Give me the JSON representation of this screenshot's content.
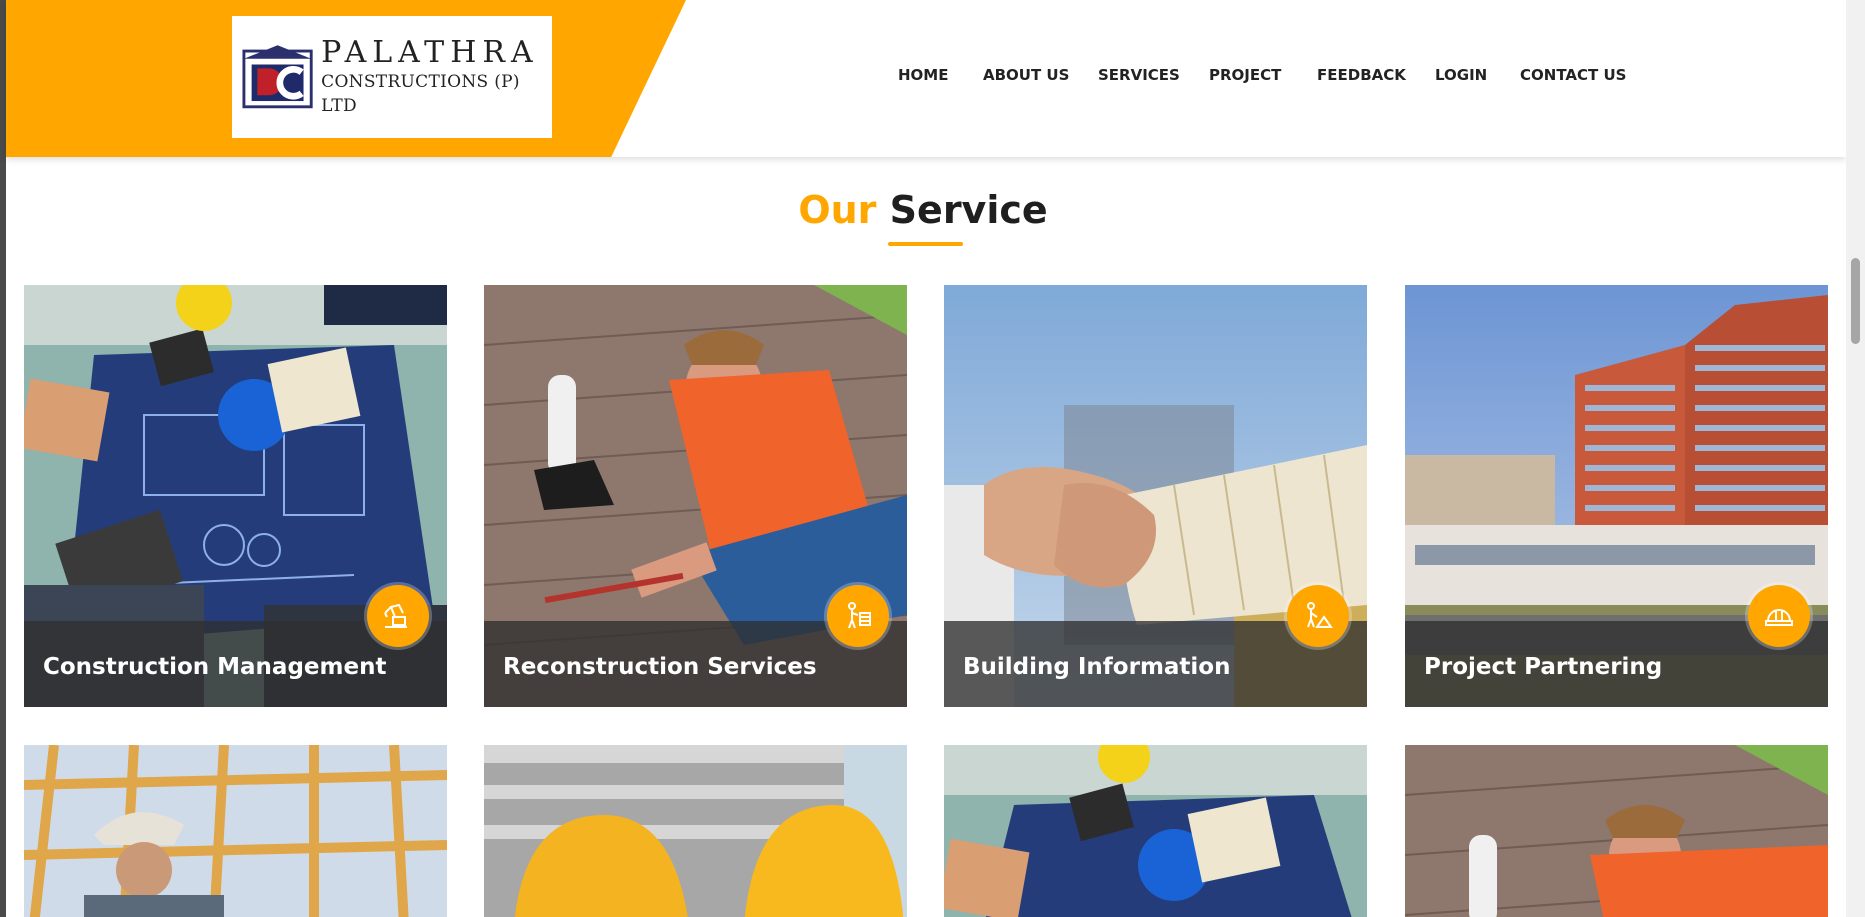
{
  "brand": {
    "name": "PALATHRA",
    "subtitle": "CONSTRUCTIONS (P) LTD",
    "monogram": "PC",
    "accent_color": "#ffa600"
  },
  "nav": {
    "items": [
      {
        "label": "HOME"
      },
      {
        "label": "ABOUT US"
      },
      {
        "label": "SERVICES"
      },
      {
        "label": "PROJECT"
      },
      {
        "label": "FEEDBACK"
      },
      {
        "label": "LOGIN"
      },
      {
        "label": "CONTACT US"
      }
    ]
  },
  "section": {
    "title_accent": "Our",
    "title_main": "Service"
  },
  "services": [
    {
      "title": "Construction Management",
      "icon": "excavator-icon"
    },
    {
      "title": "Reconstruction Services",
      "icon": "builder-wall-icon"
    },
    {
      "title": "Building Information",
      "icon": "worker-sand-icon"
    },
    {
      "title": "Project Partnering",
      "icon": "hard-hat-icon"
    }
  ],
  "more_services": [
    {
      "image": "wood-frame-worker"
    },
    {
      "image": "hardhats-building"
    },
    {
      "image": "blueprint-meeting"
    },
    {
      "image": "roof-worker"
    }
  ]
}
